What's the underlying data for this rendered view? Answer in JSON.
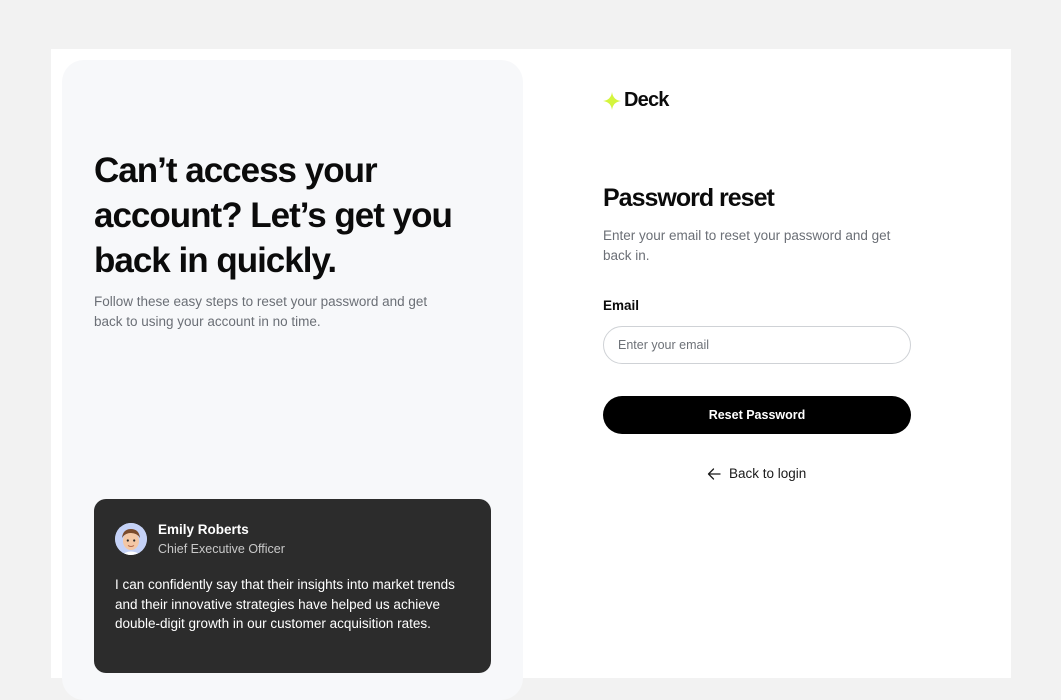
{
  "hero": {
    "title": "Can’t access your account? Let’s get you back in quickly.",
    "subtitle": "Follow these easy steps to reset your password and get back to using your account in no time."
  },
  "testimonial": {
    "name": "Emily Roberts",
    "role": "Chief Executive Officer",
    "quote": "I can confidently say that their insights into market trends and their innovative strategies have helped us achieve double-digit growth in our customer acquisition rates."
  },
  "brand": {
    "name": "Deck",
    "accent_color": "#d4f53c"
  },
  "form": {
    "title": "Password reset",
    "subtitle": "Enter your email to reset your password and get back in.",
    "email_label": "Email",
    "email_placeholder": "Enter your email",
    "email_value": "",
    "submit_label": "Reset Password",
    "back_label": "Back to login"
  },
  "icons": {
    "brand": "sparkle-icon",
    "back": "arrow-left-icon",
    "avatar": "avatar-memoji"
  }
}
